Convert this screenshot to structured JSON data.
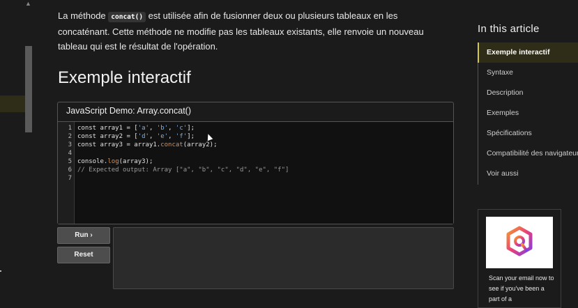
{
  "intro": {
    "before_code": "La méthode ",
    "code": "concat()",
    "after_code": " est utilisée afin de fusionner deux ou plusieurs tableaux en les concaténant. Cette méthode ne modifie pas les tableaux existants, elle renvoie un nouveau tableau qui est le résultat de l'opération."
  },
  "heading": "Exemple interactif",
  "demo": {
    "title": "JavaScript Demo: Array.concat()",
    "line_numbers": [
      "1",
      "2",
      "3",
      "4",
      "5",
      "6",
      "7"
    ],
    "code_lines": {
      "l1a": "const array1 = [",
      "l1s1": "'a'",
      "l1c1": ", ",
      "l1s2": "'b'",
      "l1c2": ", ",
      "l1s3": "'c'",
      "l1e": "];",
      "l2a": "const array2 = [",
      "l2s1": "'d'",
      "l2c1": ", ",
      "l2s2": "'e'",
      "l2c2": ", ",
      "l2s3": "'f'",
      "l2e": "];",
      "l3a": "const array3 = array1.",
      "l3f": "concat",
      "l3e": "(array2);",
      "l5a": "console.",
      "l5f": "log",
      "l5e": "(array3);",
      "l6": "// Expected output: Array [\"a\", \"b\", \"c\", \"d\", \"e\", \"f\"]"
    },
    "run_label": "Run ›",
    "reset_label": "Reset"
  },
  "toc": {
    "title": "In this article",
    "items": [
      "Exemple interactif",
      "Syntaxe",
      "Description",
      "Exemples",
      "Spécifications",
      "Compatibilité des navigateurs",
      "Voir aussi"
    ]
  },
  "ad": {
    "text": "Scan your email now to see if you've been a part of a"
  },
  "colors": {
    "accent": "#d4c84a",
    "background": "#1b1b1b",
    "string": "#7fb2e8",
    "function": "#d8915a"
  },
  "icons": {
    "logo": "hexagon-q-logo",
    "cursor": "mouse-pointer-icon"
  }
}
